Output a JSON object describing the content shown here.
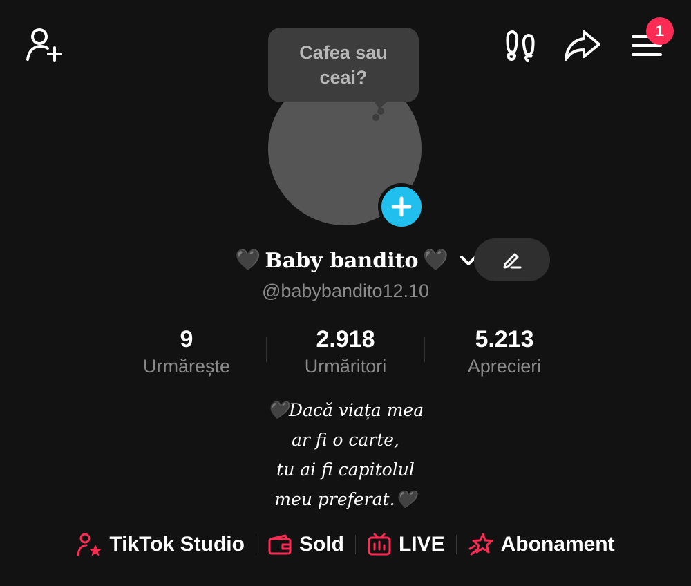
{
  "header": {
    "notification_count": "1",
    "icons": [
      "add-friend-icon",
      "footprints-icon",
      "share-icon",
      "menu-icon"
    ]
  },
  "avatar": {
    "note_text": "Cafea sau\nceai?"
  },
  "profile": {
    "heart_left": "🖤",
    "display_name": "Baby bandito",
    "heart_right": "🖤",
    "handle": "@babybandito12.10"
  },
  "stats": [
    {
      "value": "9",
      "label": "Urmărește"
    },
    {
      "value": "2.918",
      "label": "Urmăritori"
    },
    {
      "value": "5.213",
      "label": "Aprecieri"
    }
  ],
  "bio": {
    "lines": [
      "🖤Dacă viața mea",
      "ar fi o carte,",
      "tu ai fi capitolul",
      "meu preferat.🖤"
    ]
  },
  "links": [
    {
      "label": "TikTok Studio",
      "icon": "creator-star-icon"
    },
    {
      "label": "Sold",
      "icon": "wallet-icon"
    },
    {
      "label": "LIVE",
      "icon": "live-tv-icon"
    },
    {
      "label": "Abonament",
      "icon": "subscription-star-icon"
    }
  ],
  "colors": {
    "background": "#121212",
    "accent": "#fe2c55",
    "avatar_add": "#20bfee",
    "muted_text": "#8a8a8a"
  }
}
